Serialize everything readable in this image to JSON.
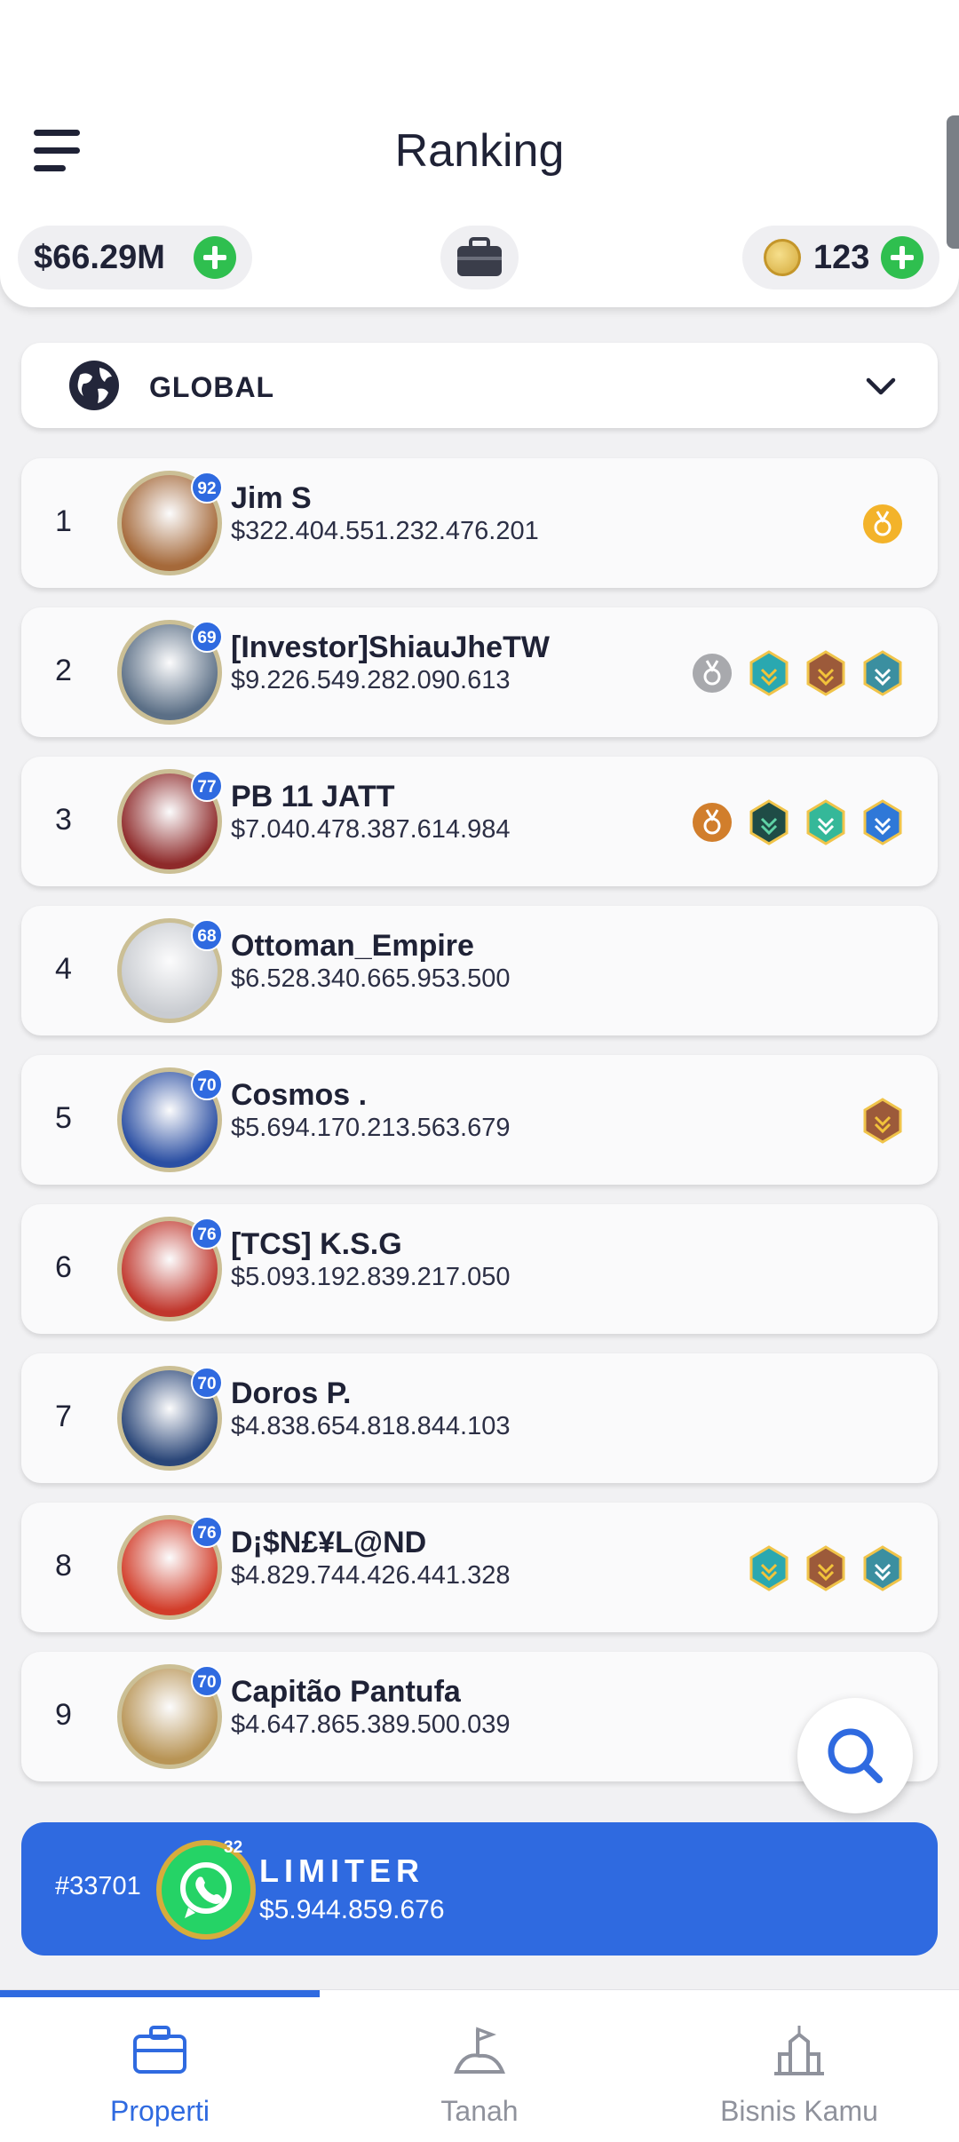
{
  "header": {
    "title": "Ranking",
    "money": "$66.29M",
    "coins": "123"
  },
  "filter": {
    "selected": "GLOBAL"
  },
  "players": [
    {
      "rank": "1",
      "level": "92",
      "name": "Jim S",
      "value": "$322.404.551.232.476.201",
      "avatar_color": "#a5693a",
      "badges": [
        "gold-medal"
      ]
    },
    {
      "rank": "2",
      "level": "69",
      "name": "[Investor]ShiauJheTW",
      "value": "$9.226.549.282.090.613",
      "avatar_color": "#5b6f86",
      "badges": [
        "silver-medal",
        "teal-hex",
        "bronze-hex",
        "chevron-hex"
      ]
    },
    {
      "rank": "3",
      "level": "77",
      "name": "PB 11 JATT",
      "value": "$7.040.478.387.614.984",
      "avatar_color": "#8e2a2a",
      "badges": [
        "bronze-medal",
        "dark-chevron-hex",
        "green-hex",
        "blue-chevron-hex"
      ]
    },
    {
      "rank": "4",
      "level": "68",
      "name": "Ottoman_Empire",
      "value": "$6.528.340.665.953.500",
      "avatar_color": "#c9ccd1",
      "badges": []
    },
    {
      "rank": "5",
      "level": "70",
      "name": "Cosmos  .",
      "value": "$5.694.170.213.563.679",
      "avatar_color": "#2b4fa3",
      "badges": [
        "bronze-hex"
      ]
    },
    {
      "rank": "6",
      "level": "76",
      "name": "[TCS] K.S.G",
      "value": "$5.093.192.839.217.050",
      "avatar_color": "#c0362c",
      "badges": []
    },
    {
      "rank": "7",
      "level": "70",
      "name": "Doros P.",
      "value": "$4.838.654.818.844.103",
      "avatar_color": "#2a4678",
      "badges": []
    },
    {
      "rank": "8",
      "level": "76",
      "name": "D¡$N£¥L@ND",
      "value": "$4.829.744.426.441.328",
      "avatar_color": "#d23d2a",
      "badges": [
        "teal-hex",
        "bronze-hex",
        "chevron-hex"
      ]
    },
    {
      "rank": "9",
      "level": "70",
      "name": "Capitão Pantufa",
      "value": "$4.647.865.389.500.039",
      "avatar_color": "#b89455",
      "badges": []
    }
  ],
  "my_rank": {
    "rank": "#33701",
    "level": "32",
    "name": "LIMITER",
    "value": "$5.944.859.676"
  },
  "nav": {
    "tabs": [
      {
        "label": "Properti",
        "icon": "briefcase-icon",
        "active": true
      },
      {
        "label": "Tanah",
        "icon": "land-flag-icon",
        "active": false
      },
      {
        "label": "Bisnis Kamu",
        "icon": "building-icon",
        "active": false
      }
    ]
  }
}
